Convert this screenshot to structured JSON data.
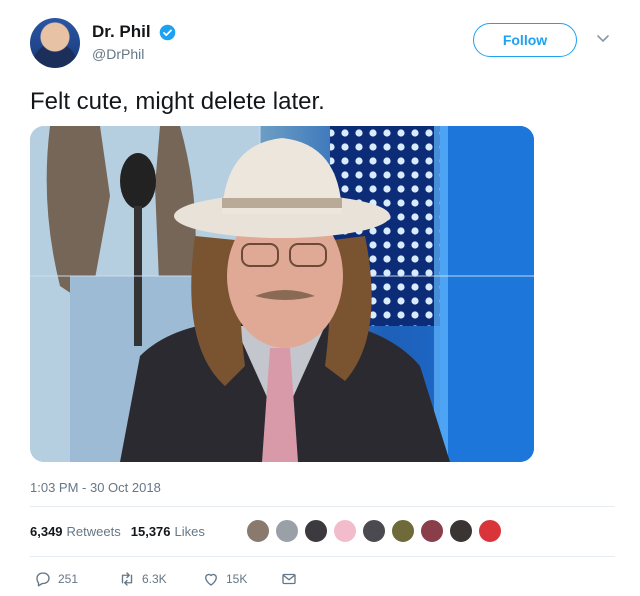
{
  "user": {
    "display_name": "Dr. Phil",
    "handle": "@DrPhil",
    "follow_label": "Follow",
    "verified_color": "#1da1f2"
  },
  "tweet": {
    "text": "Felt cute, might delete later.",
    "timestamp": "1:03 PM - 30 Oct 2018"
  },
  "stats": {
    "retweets_count": "6,349",
    "retweets_label": "Retweets",
    "likes_count": "15,376",
    "likes_label": "Likes"
  },
  "liker_avatars": [
    {
      "name": "liker-avatar-1",
      "color": "#8a7a6e"
    },
    {
      "name": "liker-avatar-2",
      "color": "#9aa0a8"
    },
    {
      "name": "liker-avatar-3",
      "color": "#3c3a3e"
    },
    {
      "name": "liker-avatar-4",
      "color": "#f2bccc"
    },
    {
      "name": "liker-avatar-5",
      "color": "#4a4a50"
    },
    {
      "name": "liker-avatar-6",
      "color": "#6e6a3a"
    },
    {
      "name": "liker-avatar-7",
      "color": "#8a3e4a"
    },
    {
      "name": "liker-avatar-8",
      "color": "#3a3532"
    },
    {
      "name": "liker-avatar-9",
      "color": "#d8343a"
    }
  ],
  "actions": {
    "reply_count": "251",
    "retweet_count": "6.3K",
    "like_count": "15K"
  },
  "icons": {
    "reply": "reply-icon",
    "retweet": "retweet-icon",
    "like": "heart-icon",
    "dm": "envelope-icon"
  }
}
